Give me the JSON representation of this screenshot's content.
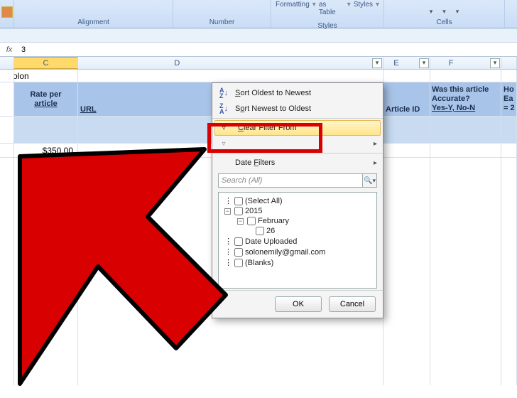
{
  "ribbon": {
    "groups": {
      "alignment": "Alignment",
      "number": "Number",
      "formatting": "Formatting",
      "as_table": "as Table",
      "styles_btn": "Styles",
      "styles_group": "Styles",
      "cells": "Cells"
    }
  },
  "formula_bar": {
    "fx": "fx",
    "value": "3"
  },
  "columns": {
    "c": "C",
    "d": "D",
    "e": "E",
    "f": "F"
  },
  "row1": {
    "solon": "Solon"
  },
  "headers": {
    "rate_line1": "Rate per",
    "rate_line2": "article",
    "url": "URL",
    "article_id": "Article ID",
    "accurate_l1": "Was this article",
    "accurate_l2": "Accurate?",
    "accurate_l3": "Yes-Y, No-N",
    "how_l1": "Ho",
    "how_l2": "Ea",
    "how_l3": "= 2"
  },
  "data": {
    "rate_value": "$350.00"
  },
  "filter_menu": {
    "sort_oldest": "Sort Oldest to Newest",
    "sort_newest": "Sort Newest to Oldest",
    "clear_filter": "Clear Filter From",
    "date_filters": "Date Filters",
    "search_placeholder": "Search (All)",
    "tree": {
      "select_all": "(Select All)",
      "y2015": "2015",
      "feb": "February",
      "d26": "26",
      "date_uploaded": "Date Uploaded",
      "email": "solonemily@gmail.com",
      "blanks": "(Blanks)"
    },
    "ok": "OK",
    "cancel": "Cancel"
  }
}
